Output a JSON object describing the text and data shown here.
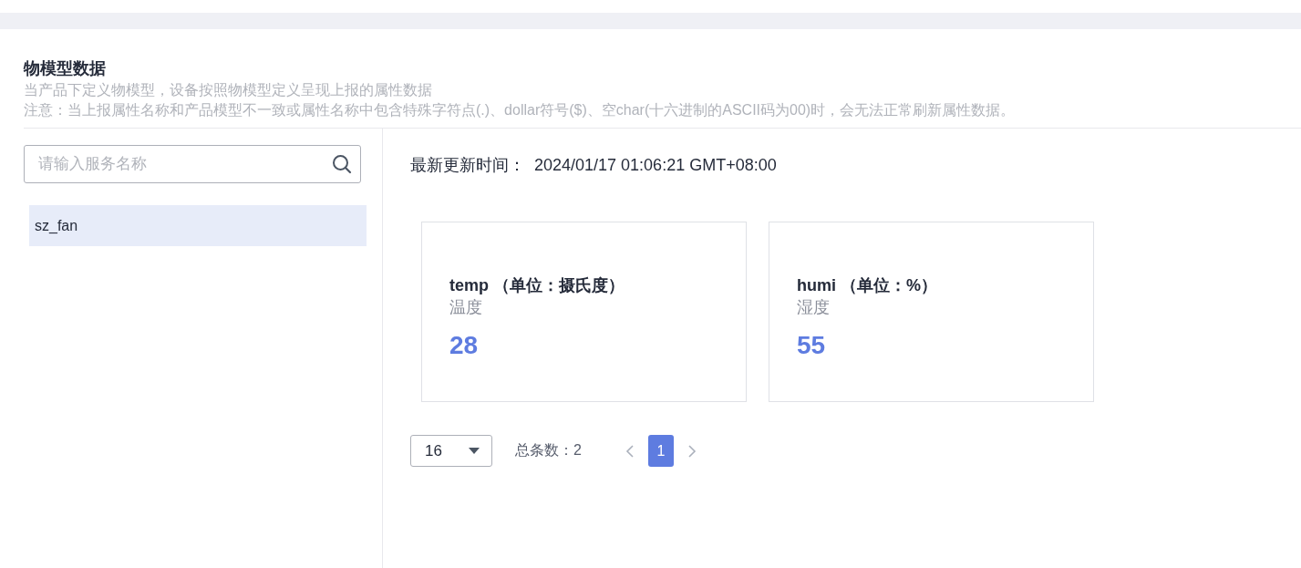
{
  "header": {
    "title": "物模型数据",
    "description": "当产品下定义物模型，设备按照物模型定义呈现上报的属性数据",
    "notice": "注意：当上报属性名称和产品模型不一致或属性名称中包含特殊字符点(.)、dollar符号($)、空char(十六进制的ASCII码为00)时，会无法正常刷新属性数据。"
  },
  "sidebar": {
    "search": {
      "placeholder": "请输入服务名称"
    },
    "items": [
      {
        "label": "sz_fan",
        "selected": true
      }
    ]
  },
  "update_time": {
    "label": "最新更新时间：",
    "value": "2024/01/17 01:06:21 GMT+08:00"
  },
  "properties": [
    {
      "name": "temp （单位：摄氏度）",
      "description": "温度",
      "value": "28"
    },
    {
      "name": "humi （单位：%）",
      "description": "湿度",
      "value": "55"
    }
  ],
  "pagination": {
    "page_size": "16",
    "total": "总条数：2",
    "pages": [
      {
        "label": "1",
        "selected": true
      }
    ]
  }
}
